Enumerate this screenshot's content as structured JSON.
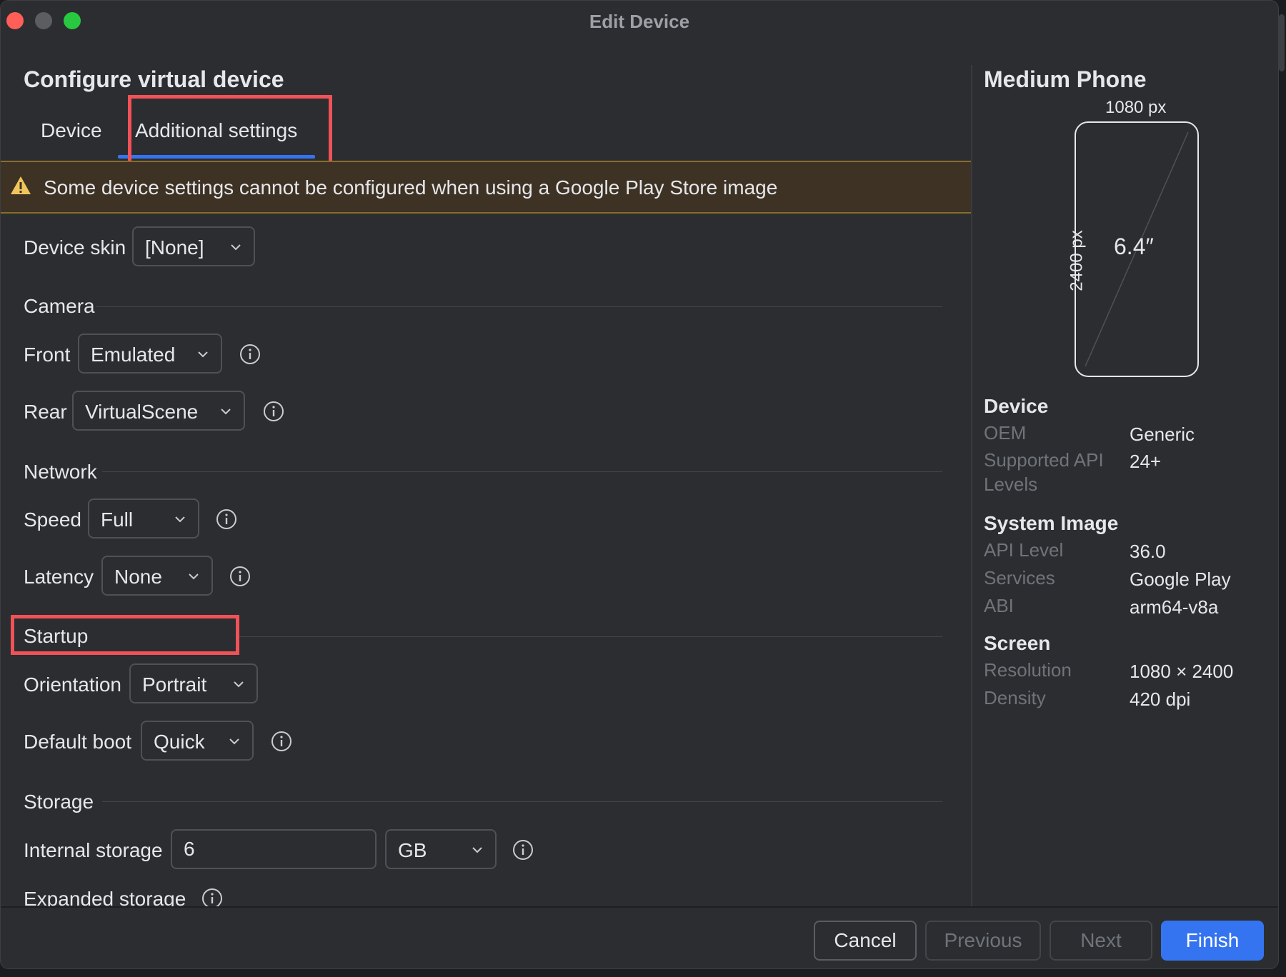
{
  "window": {
    "title": "Edit Device"
  },
  "page": {
    "title": "Configure virtual device"
  },
  "tabs": [
    {
      "label": "Device",
      "selected": false
    },
    {
      "label": "Additional settings",
      "selected": true
    }
  ],
  "warning": {
    "icon": "warning-icon",
    "text": "Some device settings cannot be configured when using a Google Play Store image"
  },
  "device_skin": {
    "label": "Device skin",
    "value": "[None]"
  },
  "camera": {
    "section": "Camera",
    "front": {
      "label": "Front",
      "value": "Emulated"
    },
    "rear": {
      "label": "Rear",
      "value": "VirtualScene"
    }
  },
  "network": {
    "section": "Network",
    "speed": {
      "label": "Speed",
      "value": "Full"
    },
    "latency": {
      "label": "Latency",
      "value": "None"
    }
  },
  "startup": {
    "section": "Startup",
    "orientation": {
      "label": "Orientation",
      "value": "Portrait"
    },
    "default_boot": {
      "label": "Default boot",
      "value": "Quick"
    }
  },
  "storage": {
    "section": "Storage",
    "internal": {
      "label": "Internal storage",
      "value": "6",
      "unit": "GB"
    },
    "expanded": {
      "label": "Expanded storage"
    }
  },
  "preview": {
    "name": "Medium Phone",
    "width_label": "1080 px",
    "height_label": "2400 px",
    "diagonal": "6.4″"
  },
  "specs": {
    "device_heading": "Device",
    "oem_key": "OEM",
    "oem_val": "Generic",
    "api_key": "Supported API Levels",
    "api_val": "24+",
    "system_heading": "System Image",
    "api_level_key": "API Level",
    "api_level_val": "36.0",
    "services_key": "Services",
    "services_val": "Google Play",
    "abi_key": "ABI",
    "abi_val": "arm64-v8a",
    "screen_heading": "Screen",
    "resolution_key": "Resolution",
    "resolution_val": "1080 × 2400",
    "density_key": "Density",
    "density_val": "420 dpi"
  },
  "buttons": {
    "cancel": "Cancel",
    "previous": "Previous",
    "next": "Next",
    "finish": "Finish"
  },
  "colors": {
    "accent": "#3574f0",
    "highlight": "#f05257",
    "warning": "#f2c55c",
    "background": "#2b2d30"
  }
}
